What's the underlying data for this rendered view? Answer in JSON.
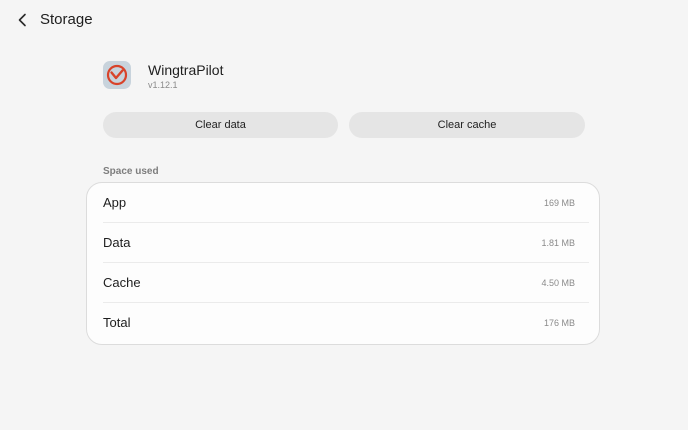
{
  "header": {
    "title": "Storage",
    "back_icon": "chevron-left-icon"
  },
  "app": {
    "name": "WingtraPilot",
    "version": "v1.12.1",
    "icon": "wingtra-logo-icon",
    "icon_bg": "#c8d3dc",
    "icon_accent": "#d8432a"
  },
  "actions": {
    "clear_data_label": "Clear data",
    "clear_cache_label": "Clear cache"
  },
  "space_used": {
    "section_label": "Space used",
    "rows": [
      {
        "label": "App",
        "value": "169 MB"
      },
      {
        "label": "Data",
        "value": "1.81 MB"
      },
      {
        "label": "Cache",
        "value": "4.50 MB"
      },
      {
        "label": "Total",
        "value": "176 MB"
      }
    ]
  }
}
